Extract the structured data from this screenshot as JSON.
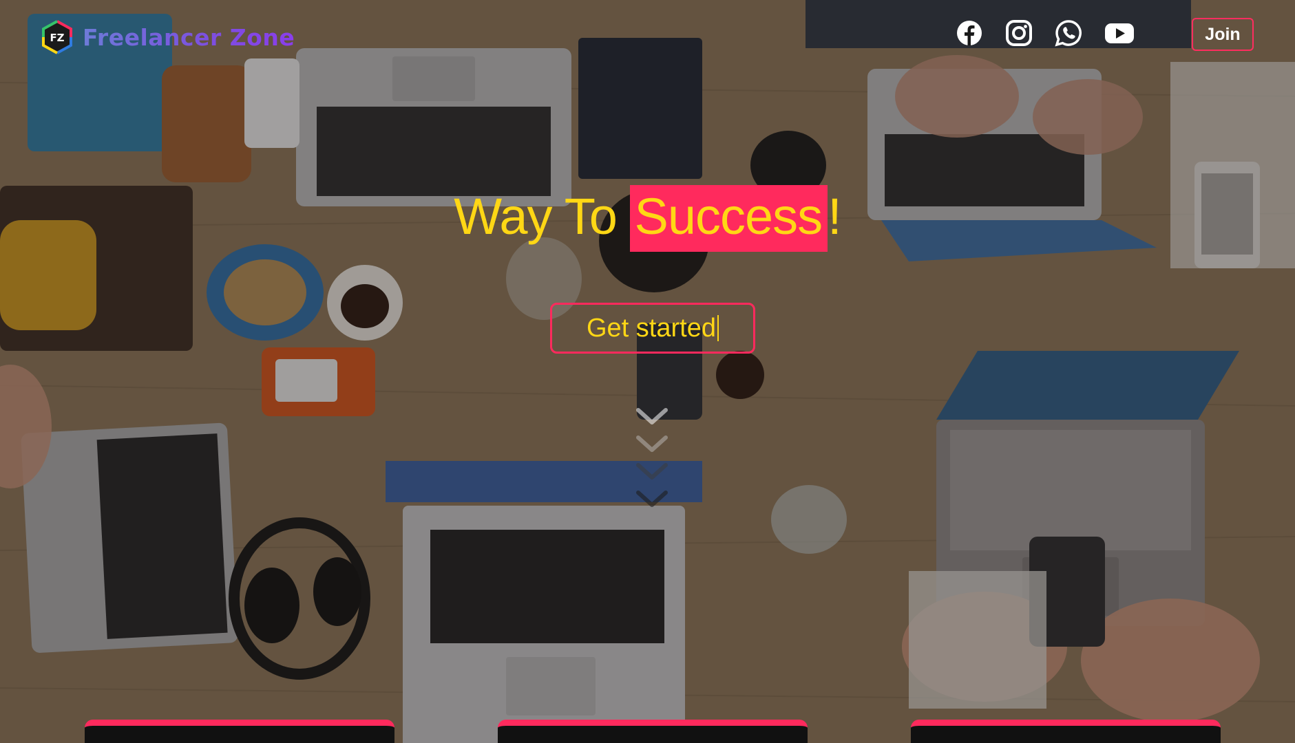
{
  "brand": {
    "logo_text": "FZ",
    "name": "Freelancer Zone"
  },
  "social": [
    {
      "name": "facebook"
    },
    {
      "name": "instagram"
    },
    {
      "name": "whatsapp"
    },
    {
      "name": "youtube"
    }
  ],
  "nav": {
    "join_label": "Join"
  },
  "hero": {
    "headline_before": "Way To ",
    "headline_highlight": "Success",
    "headline_after": "!",
    "cta_label": "Get started"
  },
  "colors": {
    "accent": "#ff2a5d",
    "headline": "#ffd715",
    "brand_gradient_start": "#6d7bd8",
    "brand_gradient_end": "#8a3dec"
  }
}
